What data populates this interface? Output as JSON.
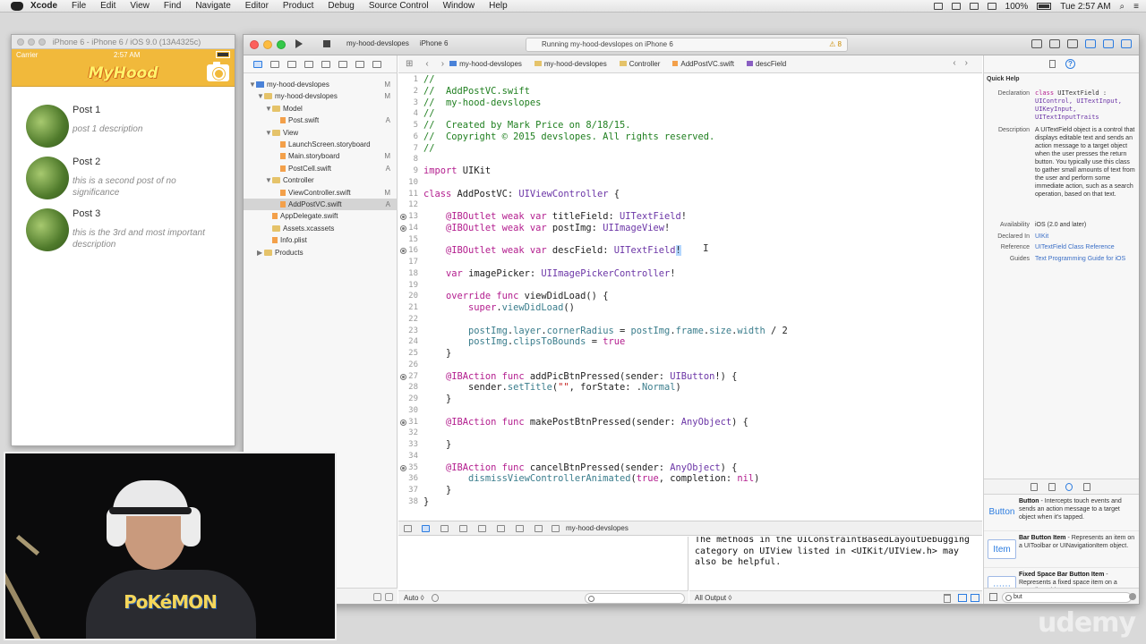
{
  "menubar": {
    "items": [
      "Xcode",
      "File",
      "Edit",
      "View",
      "Find",
      "Navigate",
      "Editor",
      "Product",
      "Debug",
      "Source Control",
      "Window",
      "Help"
    ],
    "battery": "100%",
    "clock": "Tue 2:57 AM"
  },
  "simulator": {
    "title": "iPhone 6 - iPhone 6 / iOS 9.0 (13A4325c)",
    "carrier": "Carrier",
    "time": "2:57 AM",
    "app_logo": "MyHood",
    "posts": [
      {
        "title": "Post 1",
        "description": "post 1 description"
      },
      {
        "title": "Post 2",
        "description": "this is a second post of no significance"
      },
      {
        "title": "Post 3",
        "description": "this is the 3rd and most important description"
      }
    ]
  },
  "toolbar": {
    "scheme": "my-hood-devslopes",
    "device": "iPhone 6",
    "activity": "Running my-hood-devslopes on iPhone 6",
    "warnings": "8"
  },
  "navigator": {
    "rows": [
      {
        "label": "my-hood-devslopes",
        "kind": "proj",
        "tri": "▼",
        "indent": 0,
        "badge": "M"
      },
      {
        "label": "my-hood-devslopes",
        "kind": "folder",
        "tri": "▼",
        "indent": 1,
        "badge": "M"
      },
      {
        "label": "Model",
        "kind": "folder",
        "tri": "▼",
        "indent": 2,
        "badge": ""
      },
      {
        "label": "Post.swift",
        "kind": "file",
        "tri": "",
        "indent": 3,
        "badge": "A"
      },
      {
        "label": "View",
        "kind": "folder",
        "tri": "▼",
        "indent": 2,
        "badge": ""
      },
      {
        "label": "LaunchScreen.storyboard",
        "kind": "file",
        "tri": "",
        "indent": 3,
        "badge": ""
      },
      {
        "label": "Main.storyboard",
        "kind": "file",
        "tri": "",
        "indent": 3,
        "badge": "M"
      },
      {
        "label": "PostCell.swift",
        "kind": "file",
        "tri": "",
        "indent": 3,
        "badge": "A"
      },
      {
        "label": "Controller",
        "kind": "folder",
        "tri": "▼",
        "indent": 2,
        "badge": ""
      },
      {
        "label": "ViewController.swift",
        "kind": "file",
        "tri": "",
        "indent": 3,
        "badge": "M"
      },
      {
        "label": "AddPostVC.swift",
        "kind": "file",
        "tri": "",
        "indent": 3,
        "badge": "A",
        "selected": true
      },
      {
        "label": "AppDelegate.swift",
        "kind": "file",
        "tri": "",
        "indent": 2,
        "badge": ""
      },
      {
        "label": "Assets.xcassets",
        "kind": "folder",
        "tri": "",
        "indent": 2,
        "badge": ""
      },
      {
        "label": "Info.plist",
        "kind": "file",
        "tri": "",
        "indent": 2,
        "badge": ""
      },
      {
        "label": "Products",
        "kind": "folder",
        "tri": "▶",
        "indent": 1,
        "badge": ""
      }
    ]
  },
  "jumpbar": {
    "crumbs": [
      "my-hood-devslopes",
      "my-hood-devslopes",
      "Controller",
      "AddPostVC.swift",
      "descField"
    ]
  },
  "editor": {
    "lines": [
      {
        "n": "1",
        "dot": false,
        "segs": [
          {
            "c": "cmt",
            "t": "//"
          }
        ]
      },
      {
        "n": "2",
        "dot": false,
        "segs": [
          {
            "c": "cmt",
            "t": "//  AddPostVC.swift"
          }
        ]
      },
      {
        "n": "3",
        "dot": false,
        "segs": [
          {
            "c": "cmt",
            "t": "//  my-hood-devslopes"
          }
        ]
      },
      {
        "n": "4",
        "dot": false,
        "segs": [
          {
            "c": "cmt",
            "t": "//"
          }
        ]
      },
      {
        "n": "5",
        "dot": false,
        "segs": [
          {
            "c": "cmt",
            "t": "//  Created by Mark Price on 8/18/15."
          }
        ]
      },
      {
        "n": "6",
        "dot": false,
        "segs": [
          {
            "c": "cmt",
            "t": "//  Copyright © 2015 devslopes. All rights reserved."
          }
        ]
      },
      {
        "n": "7",
        "dot": false,
        "segs": [
          {
            "c": "cmt",
            "t": "//"
          }
        ]
      },
      {
        "n": "8",
        "dot": false,
        "segs": []
      },
      {
        "n": "9",
        "dot": false,
        "segs": [
          {
            "c": "kw",
            "t": "import"
          },
          {
            "c": "pl",
            "t": " UIKit"
          }
        ]
      },
      {
        "n": "10",
        "dot": false,
        "segs": []
      },
      {
        "n": "11",
        "dot": false,
        "segs": [
          {
            "c": "kw",
            "t": "class"
          },
          {
            "c": "pl",
            "t": " AddPostVC: "
          },
          {
            "c": "ty",
            "t": "UIViewController"
          },
          {
            "c": "pl",
            "t": " {"
          }
        ]
      },
      {
        "n": "12",
        "dot": false,
        "segs": []
      },
      {
        "n": "13",
        "dot": true,
        "segs": [
          {
            "c": "pl",
            "t": "    "
          },
          {
            "c": "kw",
            "t": "@IBOutlet weak var"
          },
          {
            "c": "pl",
            "t": " titleField: "
          },
          {
            "c": "ty",
            "t": "UITextField"
          },
          {
            "c": "pl",
            "t": "!"
          }
        ]
      },
      {
        "n": "14",
        "dot": true,
        "segs": [
          {
            "c": "pl",
            "t": "    "
          },
          {
            "c": "kw",
            "t": "@IBOutlet weak var"
          },
          {
            "c": "pl",
            "t": " postImg: "
          },
          {
            "c": "ty",
            "t": "UIImageView"
          },
          {
            "c": "pl",
            "t": "!"
          }
        ]
      },
      {
        "n": "15",
        "dot": false,
        "segs": []
      },
      {
        "n": "16",
        "dot": true,
        "segs": [
          {
            "c": "pl",
            "t": "    "
          },
          {
            "c": "kw",
            "t": "@IBOutlet weak var"
          },
          {
            "c": "pl",
            "t": " descField: "
          },
          {
            "c": "ty",
            "t": "UITextField"
          },
          {
            "c": "sel-bg",
            "t": "!"
          }
        ]
      },
      {
        "n": "17",
        "dot": false,
        "segs": []
      },
      {
        "n": "18",
        "dot": false,
        "segs": [
          {
            "c": "pl",
            "t": "    "
          },
          {
            "c": "kw",
            "t": "var"
          },
          {
            "c": "pl",
            "t": " imagePicker: "
          },
          {
            "c": "ty",
            "t": "UIImagePickerController"
          },
          {
            "c": "pl",
            "t": "!"
          }
        ]
      },
      {
        "n": "19",
        "dot": false,
        "segs": []
      },
      {
        "n": "20",
        "dot": false,
        "segs": [
          {
            "c": "pl",
            "t": "    "
          },
          {
            "c": "kw",
            "t": "override func"
          },
          {
            "c": "pl",
            "t": " viewDidLoad() {"
          }
        ]
      },
      {
        "n": "21",
        "dot": false,
        "segs": [
          {
            "c": "pl",
            "t": "        "
          },
          {
            "c": "kw",
            "t": "super"
          },
          {
            "c": "pl",
            "t": "."
          },
          {
            "c": "pr",
            "t": "viewDidLoad"
          },
          {
            "c": "pl",
            "t": "()"
          }
        ]
      },
      {
        "n": "22",
        "dot": false,
        "segs": []
      },
      {
        "n": "23",
        "dot": false,
        "segs": [
          {
            "c": "pl",
            "t": "        "
          },
          {
            "c": "pr",
            "t": "postImg"
          },
          {
            "c": "pl",
            "t": "."
          },
          {
            "c": "pr",
            "t": "layer"
          },
          {
            "c": "pl",
            "t": "."
          },
          {
            "c": "pr",
            "t": "cornerRadius"
          },
          {
            "c": "pl",
            "t": " = "
          },
          {
            "c": "pr",
            "t": "postImg"
          },
          {
            "c": "pl",
            "t": "."
          },
          {
            "c": "pr",
            "t": "frame"
          },
          {
            "c": "pl",
            "t": "."
          },
          {
            "c": "pr",
            "t": "size"
          },
          {
            "c": "pl",
            "t": "."
          },
          {
            "c": "pr",
            "t": "width"
          },
          {
            "c": "pl",
            "t": " / 2"
          }
        ]
      },
      {
        "n": "24",
        "dot": false,
        "segs": [
          {
            "c": "pl",
            "t": "        "
          },
          {
            "c": "pr",
            "t": "postImg"
          },
          {
            "c": "pl",
            "t": "."
          },
          {
            "c": "pr",
            "t": "clipsToBounds"
          },
          {
            "c": "pl",
            "t": " = "
          },
          {
            "c": "kw",
            "t": "true"
          }
        ]
      },
      {
        "n": "25",
        "dot": false,
        "segs": [
          {
            "c": "pl",
            "t": "    }"
          }
        ]
      },
      {
        "n": "26",
        "dot": false,
        "segs": []
      },
      {
        "n": "27",
        "dot": true,
        "segs": [
          {
            "c": "pl",
            "t": "    "
          },
          {
            "c": "kw",
            "t": "@IBAction func"
          },
          {
            "c": "pl",
            "t": " addPicBtnPressed(sender: "
          },
          {
            "c": "ty",
            "t": "UIButton"
          },
          {
            "c": "pl",
            "t": "!) {"
          }
        ]
      },
      {
        "n": "28",
        "dot": false,
        "segs": [
          {
            "c": "pl",
            "t": "        sender."
          },
          {
            "c": "pr",
            "t": "setTitle"
          },
          {
            "c": "pl",
            "t": "("
          },
          {
            "c": "st",
            "t": "\"\""
          },
          {
            "c": "pl",
            "t": ", forState: ."
          },
          {
            "c": "pr",
            "t": "Normal"
          },
          {
            "c": "pl",
            "t": ")"
          }
        ]
      },
      {
        "n": "29",
        "dot": false,
        "segs": [
          {
            "c": "pl",
            "t": "    }"
          }
        ]
      },
      {
        "n": "30",
        "dot": false,
        "segs": []
      },
      {
        "n": "31",
        "dot": true,
        "segs": [
          {
            "c": "pl",
            "t": "    "
          },
          {
            "c": "kw",
            "t": "@IBAction func"
          },
          {
            "c": "pl",
            "t": " makePostBtnPressed(sender: "
          },
          {
            "c": "ty",
            "t": "AnyObject"
          },
          {
            "c": "pl",
            "t": ") {"
          }
        ]
      },
      {
        "n": "32",
        "dot": false,
        "segs": []
      },
      {
        "n": "33",
        "dot": false,
        "segs": [
          {
            "c": "pl",
            "t": "    }"
          }
        ]
      },
      {
        "n": "34",
        "dot": false,
        "segs": []
      },
      {
        "n": "35",
        "dot": true,
        "segs": [
          {
            "c": "pl",
            "t": "    "
          },
          {
            "c": "kw",
            "t": "@IBAction func"
          },
          {
            "c": "pl",
            "t": " cancelBtnPressed(sender: "
          },
          {
            "c": "ty",
            "t": "AnyObject"
          },
          {
            "c": "pl",
            "t": ") {"
          }
        ]
      },
      {
        "n": "36",
        "dot": false,
        "segs": [
          {
            "c": "pl",
            "t": "        "
          },
          {
            "c": "pr",
            "t": "dismissViewControllerAnimated"
          },
          {
            "c": "pl",
            "t": "("
          },
          {
            "c": "kw",
            "t": "true"
          },
          {
            "c": "pl",
            "t": ", completion: "
          },
          {
            "c": "kw",
            "t": "nil"
          },
          {
            "c": "pl",
            "t": ")"
          }
        ]
      },
      {
        "n": "37",
        "dot": false,
        "segs": [
          {
            "c": "pl",
            "t": "    }"
          }
        ]
      },
      {
        "n": "38",
        "dot": false,
        "segs": [
          {
            "c": "pl",
            "t": "}"
          }
        ]
      }
    ]
  },
  "debug": {
    "scheme": "my-hood-devslopes",
    "vars_selector": "Auto ◊",
    "console_selector": "All Output ◊",
    "console_text": "The methods in the UIConstraintBasedLayoutDebugging category on UIView listed in <UIKit/UIView.h> may also be helpful."
  },
  "quick_help": {
    "title": "Quick Help",
    "declaration_label": "Declaration",
    "declaration_kw": "class",
    "declaration_name": " UITextField :",
    "declaration_supers": "UIControl, UITextInput, UIKeyInput, UITextInputTraits",
    "description_label": "Description",
    "description": "A UITextField object is a control that displays editable text and sends an action message to a target object when the user presses the return button. You typically use this class to gather small amounts of text from the user and perform some immediate action, such as a search operation, based on that text.",
    "availability_label": "Availability",
    "availability": "iOS (2.0 and later)",
    "declared_label": "Declared In",
    "declared": "UIKit",
    "reference_label": "Reference",
    "reference": "UITextField Class Reference",
    "guides_label": "Guides",
    "guides": "Text Programming Guide for iOS"
  },
  "library": {
    "items": [
      {
        "icon": "Button",
        "name": "Button",
        "desc": " - Intercepts touch events and sends an action message to a target object when it's tapped."
      },
      {
        "icon": "Item",
        "name": "Bar Button Item",
        "desc": " - Represents an item on a UIToolbar or UINavigationItem object."
      },
      {
        "icon": "⋯⋯",
        "name": "Fixed Space Bar Button Item",
        "desc": " - Represents a fixed space item on a UIToolbar object."
      }
    ],
    "filter_text": "but"
  },
  "webcam": {
    "shirt_text": "PoKéMON"
  },
  "watermark": "udemy"
}
